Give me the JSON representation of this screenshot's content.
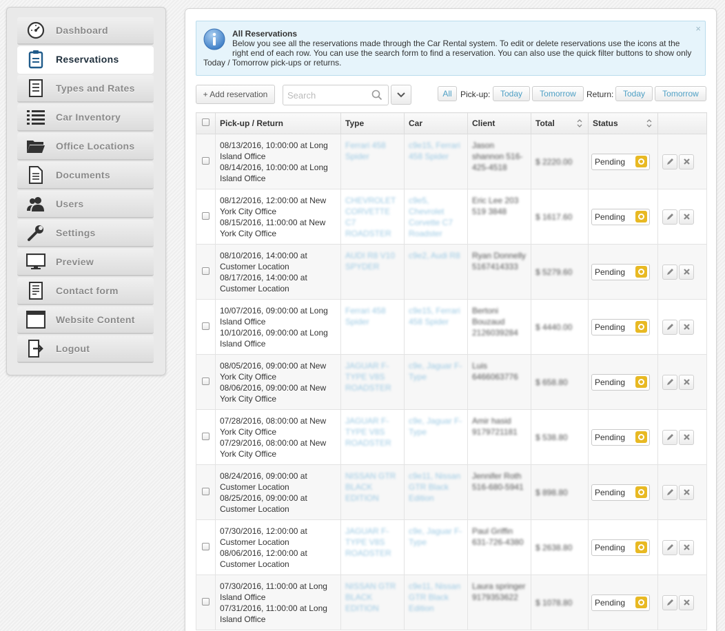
{
  "sidebar": {
    "items": [
      {
        "label": "Dashboard",
        "icon": "dashboard-gauge-icon",
        "active": false
      },
      {
        "label": "Reservations",
        "icon": "clipboard-icon",
        "active": true
      },
      {
        "label": "Types and Rates",
        "icon": "document-list-icon",
        "active": false
      },
      {
        "label": "Car Inventory",
        "icon": "list-icon",
        "active": false
      },
      {
        "label": "Office Locations",
        "icon": "folder-open-icon",
        "active": false
      },
      {
        "label": "Documents",
        "icon": "document-icon",
        "active": false
      },
      {
        "label": "Users",
        "icon": "users-icon",
        "active": false
      },
      {
        "label": "Settings",
        "icon": "wrench-icon",
        "active": false
      },
      {
        "label": "Preview",
        "icon": "monitor-icon",
        "active": false
      },
      {
        "label": "Contact form",
        "icon": "form-icon",
        "active": false
      },
      {
        "label": "Website Content",
        "icon": "window-icon",
        "active": false
      },
      {
        "label": "Logout",
        "icon": "logout-icon",
        "active": false
      }
    ]
  },
  "info": {
    "title": "All Reservations",
    "text": "Below you see all the reservations made through the Car Rental system. To edit or delete reservations use the icons at the right end of each row. You can use the search form to find a reservation. You can also use the quick filter buttons to show only",
    "text2": "Today / Tomorrow pick-ups or returns.",
    "close": "×"
  },
  "toolbar": {
    "add_label": "+ Add reservation",
    "search_placeholder": "Search",
    "all_label": "All",
    "pickup_label": "Pick-up:",
    "return_label": "Return:",
    "today_label": "Today",
    "tomorrow_label": "Tomorrow"
  },
  "table": {
    "headers": {
      "pickup": "Pick-up / Return",
      "type": "Type",
      "car": "Car",
      "client": "Client",
      "total": "Total",
      "status": "Status"
    },
    "rows": [
      {
        "pickup": "08/13/2016, 10:00:00 at Long Island Office",
        "ret": "08/14/2016, 10:00:00 at Long Island Office",
        "type": "Ferrari 458 Spider",
        "car": "c9e15, Ferrari 458 Spider",
        "client": "Jason shannon 516-425-4518",
        "total": "$ 2220.00",
        "status": "Pending"
      },
      {
        "pickup": "08/12/2016, 12:00:00 at New York City Office",
        "ret": "08/15/2016, 11:00:00 at New York City Office",
        "type": "CHEVROLET CORVETTE C7 ROADSTER",
        "car": "c9e5, Chevrolet Corvette C7 Roadster",
        "client": "Eric Lee 203 519 3848",
        "total": "$ 1617.60",
        "status": "Pending"
      },
      {
        "pickup": "08/10/2016, 14:00:00 at Customer Location",
        "ret": "08/17/2016, 14:00:00 at Customer Location",
        "type": "AUDI R8 V10 SPYDER",
        "car": "c9e2, Audi R8",
        "client": "Ryan Donnelly 5167414333",
        "total": "$ 5279.60",
        "status": "Pending"
      },
      {
        "pickup": "10/07/2016, 09:00:00 at Long Island Office",
        "ret": "10/10/2016, 09:00:00 at Long Island Office",
        "type": "Ferrari 458 Spider",
        "car": "c9e15, Ferrari 458 Spider",
        "client": "Bertoni Bouzaud 2126039284",
        "total": "$ 4440.00",
        "status": "Pending"
      },
      {
        "pickup": "08/05/2016, 09:00:00 at New York City Office",
        "ret": "08/06/2016, 09:00:00 at New York City Office",
        "type": "JAGUAR F-TYPE V8S ROADSTER",
        "car": "c9e, Jaguar F-Type",
        "client": "Luis 6466063776",
        "total": "$ 658.80",
        "status": "Pending"
      },
      {
        "pickup": "07/28/2016, 08:00:00 at New York City Office",
        "ret": "07/29/2016, 08:00:00 at New York City Office",
        "type": "JAGUAR F-TYPE V8S ROADSTER",
        "car": "c9e, Jaguar F-Type",
        "client": "Amir hasid 9179721181",
        "total": "$ 538.80",
        "status": "Pending"
      },
      {
        "pickup": "08/24/2016, 09:00:00 at Customer Location",
        "ret": "08/25/2016, 09:00:00 at Customer Location",
        "type": "NISSAN GTR BLACK EDITION",
        "car": "c9e11, Nissan GTR Black Edition",
        "client": "Jennifer Roth 516-680-5941",
        "total": "$ 898.80",
        "status": "Pending"
      },
      {
        "pickup": "07/30/2016, 12:00:00 at Customer Location",
        "ret": "08/06/2016, 12:00:00 at Customer Location",
        "type": "JAGUAR F-TYPE V8S ROADSTER",
        "car": "c9e, Jaguar F-Type",
        "client": "Paul Griffin 631-726-4380",
        "total": "$ 2638.80",
        "status": "Pending"
      },
      {
        "pickup": "07/30/2016, 11:00:00 at Long Island Office",
        "ret": "07/31/2016, 11:00:00 at Long Island Office",
        "type": "NISSAN GTR BLACK EDITION",
        "car": "c9e11, Nissan GTR Black Edition",
        "client": "Laura springer 9179353622",
        "total": "$ 1078.80",
        "status": "Pending"
      }
    ]
  },
  "colors": {
    "accent": "#4d9fc4",
    "status_pending": "#e8b923",
    "info_bg": "#e6f4fb"
  }
}
